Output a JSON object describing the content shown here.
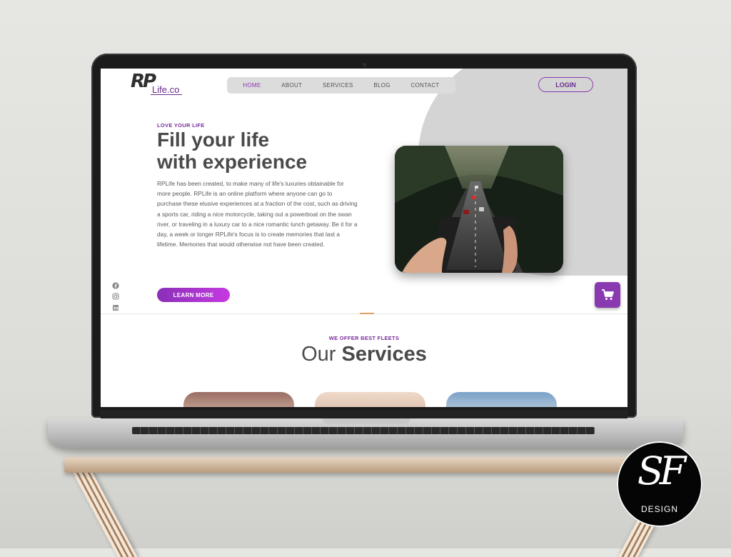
{
  "brand": {
    "logo_rp": "RP",
    "logo_life": "Life.co"
  },
  "nav": {
    "items": [
      "HOME",
      "ABOUT",
      "SERVICES",
      "BLOG",
      "CONTACT"
    ],
    "active": "HOME"
  },
  "header": {
    "login_label": "LOGIN"
  },
  "hero": {
    "eyebrow": "LOVE YOUR LIFE",
    "title_line1": "Fill your life",
    "title_line2": "with experience",
    "body": "RPLife has been created, to make many of life's luxuries obtainable for more people. RPLife is an online platform where anyone can go to purchase these elusive experiences at a fraction of the cost, such as driving a sports car, riding a nice motorcycle, taking out a powerboat on the swan river, or traveling in a luxury car to a nice romantic lunch getaway. Be it for a day, a week or longer RPLife's focus is to create memories that last a lifetime. Memories that would otherwise not have been created.",
    "cta_label": "LEARN MORE"
  },
  "social": {
    "icons": [
      "facebook-icon",
      "instagram-icon",
      "linkedin-icon"
    ]
  },
  "services": {
    "eyebrow": "WE OFFER BEST FLEETS",
    "title_light": "Our ",
    "title_bold": "Services"
  },
  "badge": {
    "monogram": "SF",
    "label": "DESIGN"
  },
  "colors": {
    "accent": "#8a3ab0",
    "heading": "#4a4a4a",
    "blob": "#d4d4d4",
    "divider_accent": "#e3a05a"
  }
}
